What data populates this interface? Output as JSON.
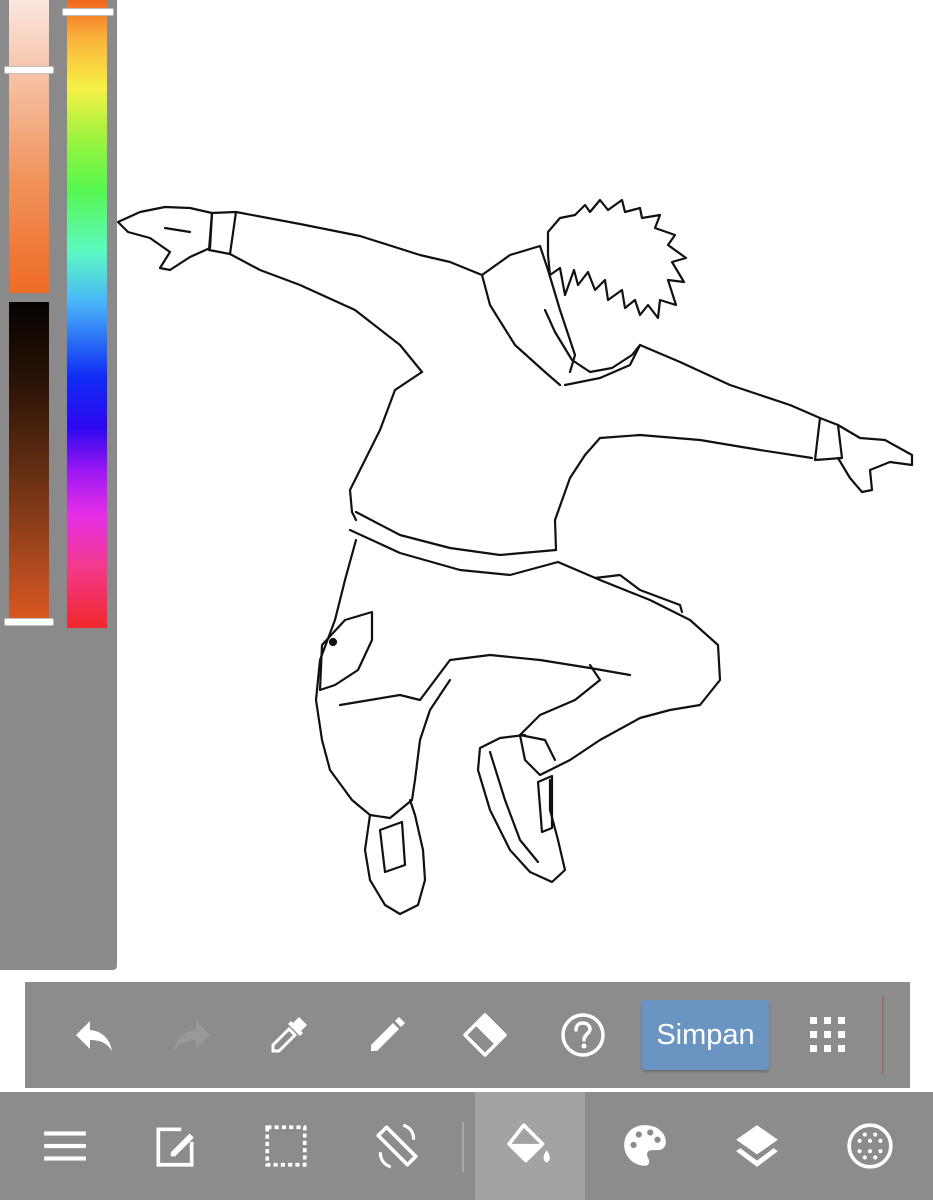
{
  "app": {
    "name": "drawing-app"
  },
  "colors": {
    "toolbar_bg": "#8c8c8c",
    "panel_bg": "#8a8a8a",
    "save_button_bg": "#6a95c3",
    "icon_color": "#ffffff",
    "icon_disabled": "#999999",
    "line_color": "#111111"
  },
  "color_panel": {
    "saturation_slider": {
      "label": "",
      "value": 0.11
    },
    "shade_slider": {
      "label": "",
      "value": 0.98
    },
    "hue_slider": {
      "label": "",
      "value": 0.02
    }
  },
  "toolbar_top": {
    "items": [
      {
        "icon": "undo-icon",
        "enabled": true
      },
      {
        "icon": "redo-icon",
        "enabled": false
      },
      {
        "icon": "eyedropper-icon",
        "enabled": true
      },
      {
        "icon": "pencil-icon",
        "enabled": true
      },
      {
        "icon": "eraser-icon",
        "enabled": true
      },
      {
        "icon": "help-icon",
        "enabled": true
      },
      {
        "icon": "grid-menu-icon",
        "enabled": true
      }
    ],
    "save_label": "Simpan"
  },
  "toolbar_bottom": {
    "items": [
      {
        "icon": "menu-icon",
        "active": false
      },
      {
        "icon": "edit-icon",
        "active": false
      },
      {
        "icon": "selection-icon",
        "active": false
      },
      {
        "icon": "rotate-screen-icon",
        "active": false
      },
      {
        "icon": "paint-bucket-icon",
        "active": true
      },
      {
        "icon": "palette-icon",
        "active": false
      },
      {
        "icon": "layers-icon",
        "active": false
      },
      {
        "icon": "brush-dots-icon",
        "active": false
      }
    ]
  }
}
